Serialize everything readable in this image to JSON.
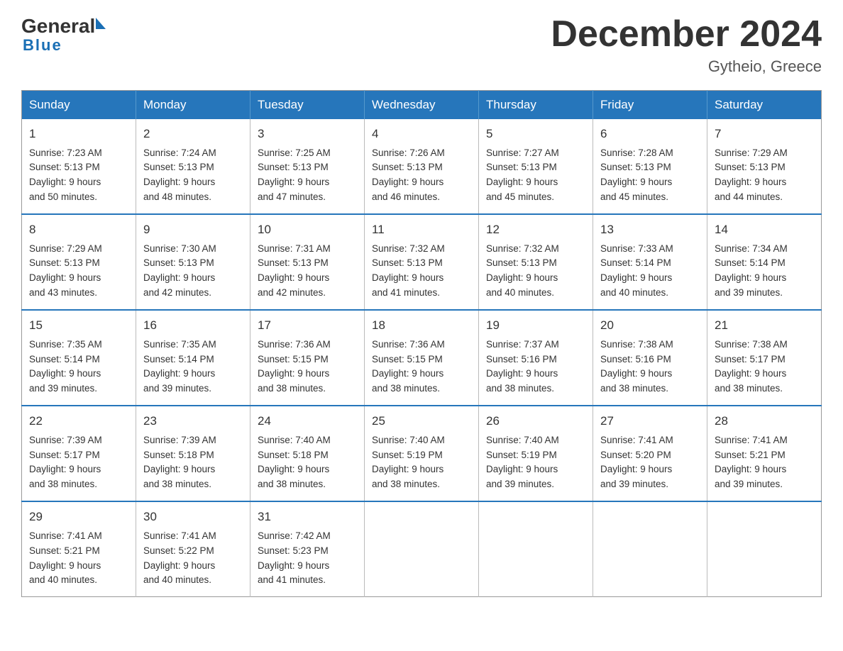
{
  "header": {
    "month_title": "December 2024",
    "location": "Gytheio, Greece",
    "logo_general": "General",
    "logo_blue": "Blue"
  },
  "days_of_week": [
    "Sunday",
    "Monday",
    "Tuesday",
    "Wednesday",
    "Thursday",
    "Friday",
    "Saturday"
  ],
  "weeks": [
    [
      {
        "day": "1",
        "sunrise": "7:23 AM",
        "sunset": "5:13 PM",
        "daylight": "9 hours and 50 minutes."
      },
      {
        "day": "2",
        "sunrise": "7:24 AM",
        "sunset": "5:13 PM",
        "daylight": "9 hours and 48 minutes."
      },
      {
        "day": "3",
        "sunrise": "7:25 AM",
        "sunset": "5:13 PM",
        "daylight": "9 hours and 47 minutes."
      },
      {
        "day": "4",
        "sunrise": "7:26 AM",
        "sunset": "5:13 PM",
        "daylight": "9 hours and 46 minutes."
      },
      {
        "day": "5",
        "sunrise": "7:27 AM",
        "sunset": "5:13 PM",
        "daylight": "9 hours and 45 minutes."
      },
      {
        "day": "6",
        "sunrise": "7:28 AM",
        "sunset": "5:13 PM",
        "daylight": "9 hours and 45 minutes."
      },
      {
        "day": "7",
        "sunrise": "7:29 AM",
        "sunset": "5:13 PM",
        "daylight": "9 hours and 44 minutes."
      }
    ],
    [
      {
        "day": "8",
        "sunrise": "7:29 AM",
        "sunset": "5:13 PM",
        "daylight": "9 hours and 43 minutes."
      },
      {
        "day": "9",
        "sunrise": "7:30 AM",
        "sunset": "5:13 PM",
        "daylight": "9 hours and 42 minutes."
      },
      {
        "day": "10",
        "sunrise": "7:31 AM",
        "sunset": "5:13 PM",
        "daylight": "9 hours and 42 minutes."
      },
      {
        "day": "11",
        "sunrise": "7:32 AM",
        "sunset": "5:13 PM",
        "daylight": "9 hours and 41 minutes."
      },
      {
        "day": "12",
        "sunrise": "7:32 AM",
        "sunset": "5:13 PM",
        "daylight": "9 hours and 40 minutes."
      },
      {
        "day": "13",
        "sunrise": "7:33 AM",
        "sunset": "5:14 PM",
        "daylight": "9 hours and 40 minutes."
      },
      {
        "day": "14",
        "sunrise": "7:34 AM",
        "sunset": "5:14 PM",
        "daylight": "9 hours and 39 minutes."
      }
    ],
    [
      {
        "day": "15",
        "sunrise": "7:35 AM",
        "sunset": "5:14 PM",
        "daylight": "9 hours and 39 minutes."
      },
      {
        "day": "16",
        "sunrise": "7:35 AM",
        "sunset": "5:14 PM",
        "daylight": "9 hours and 39 minutes."
      },
      {
        "day": "17",
        "sunrise": "7:36 AM",
        "sunset": "5:15 PM",
        "daylight": "9 hours and 38 minutes."
      },
      {
        "day": "18",
        "sunrise": "7:36 AM",
        "sunset": "5:15 PM",
        "daylight": "9 hours and 38 minutes."
      },
      {
        "day": "19",
        "sunrise": "7:37 AM",
        "sunset": "5:16 PM",
        "daylight": "9 hours and 38 minutes."
      },
      {
        "day": "20",
        "sunrise": "7:38 AM",
        "sunset": "5:16 PM",
        "daylight": "9 hours and 38 minutes."
      },
      {
        "day": "21",
        "sunrise": "7:38 AM",
        "sunset": "5:17 PM",
        "daylight": "9 hours and 38 minutes."
      }
    ],
    [
      {
        "day": "22",
        "sunrise": "7:39 AM",
        "sunset": "5:17 PM",
        "daylight": "9 hours and 38 minutes."
      },
      {
        "day": "23",
        "sunrise": "7:39 AM",
        "sunset": "5:18 PM",
        "daylight": "9 hours and 38 minutes."
      },
      {
        "day": "24",
        "sunrise": "7:40 AM",
        "sunset": "5:18 PM",
        "daylight": "9 hours and 38 minutes."
      },
      {
        "day": "25",
        "sunrise": "7:40 AM",
        "sunset": "5:19 PM",
        "daylight": "9 hours and 38 minutes."
      },
      {
        "day": "26",
        "sunrise": "7:40 AM",
        "sunset": "5:19 PM",
        "daylight": "9 hours and 39 minutes."
      },
      {
        "day": "27",
        "sunrise": "7:41 AM",
        "sunset": "5:20 PM",
        "daylight": "9 hours and 39 minutes."
      },
      {
        "day": "28",
        "sunrise": "7:41 AM",
        "sunset": "5:21 PM",
        "daylight": "9 hours and 39 minutes."
      }
    ],
    [
      {
        "day": "29",
        "sunrise": "7:41 AM",
        "sunset": "5:21 PM",
        "daylight": "9 hours and 40 minutes."
      },
      {
        "day": "30",
        "sunrise": "7:41 AM",
        "sunset": "5:22 PM",
        "daylight": "9 hours and 40 minutes."
      },
      {
        "day": "31",
        "sunrise": "7:42 AM",
        "sunset": "5:23 PM",
        "daylight": "9 hours and 41 minutes."
      },
      null,
      null,
      null,
      null
    ]
  ],
  "labels": {
    "sunrise": "Sunrise:",
    "sunset": "Sunset:",
    "daylight": "Daylight:"
  }
}
